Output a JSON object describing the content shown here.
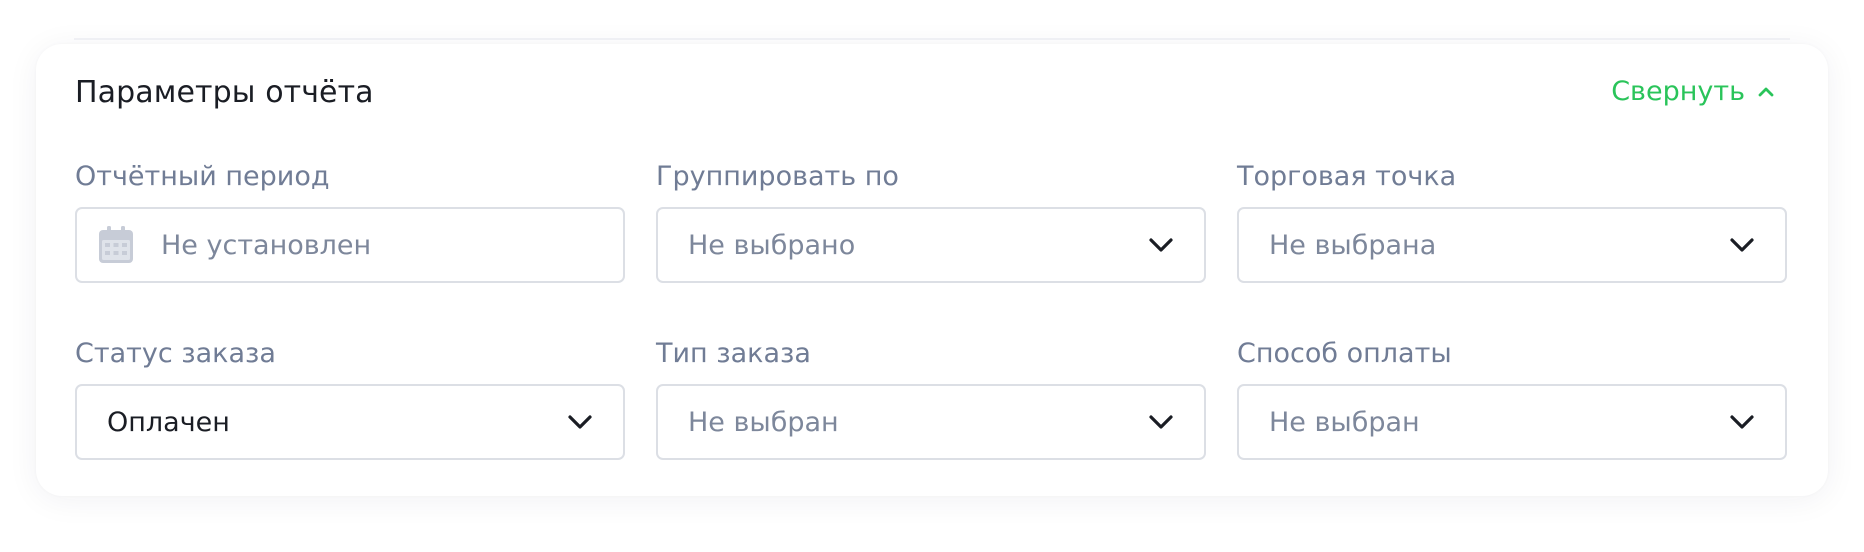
{
  "panel": {
    "title": "Параметры отчёта",
    "collapse_label": "Свернуть",
    "collapse_icon": "chevron-up-icon",
    "accent_color": "#2ac45a"
  },
  "fields": [
    {
      "label": "Отчётный период",
      "value": "Не установлен",
      "kind": "date",
      "icon": "calendar-icon"
    },
    {
      "label": "Группировать по",
      "value": "Не выбрано",
      "kind": "select",
      "icon": "chevron-down-icon"
    },
    {
      "label": "Торговая точка",
      "value": "Не выбрана",
      "kind": "select",
      "icon": "chevron-down-icon"
    },
    {
      "label": "Статус заказа",
      "value": "Оплачен",
      "kind": "select",
      "icon": "chevron-down-icon"
    },
    {
      "label": "Тип заказа",
      "value": "Не выбран",
      "kind": "select",
      "icon": "chevron-down-icon"
    },
    {
      "label": "Способ оплаты",
      "value": "Не выбран",
      "kind": "select",
      "icon": "chevron-down-icon"
    }
  ]
}
